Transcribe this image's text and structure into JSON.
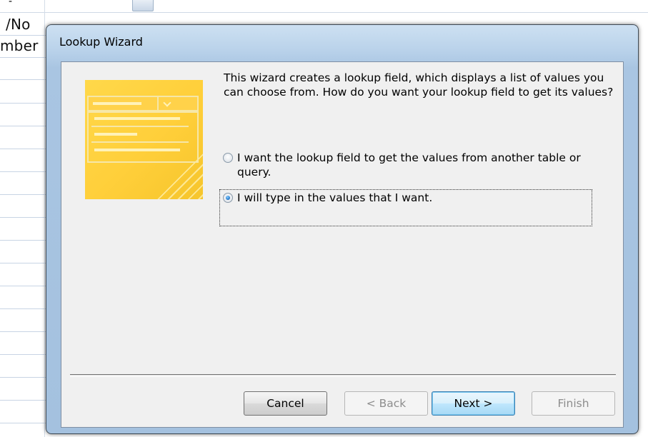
{
  "background": {
    "partial_top_text": "-",
    "visible_cells": [
      "/No",
      "mber"
    ]
  },
  "dialog": {
    "title": "Lookup Wizard",
    "description": "This wizard creates a lookup field, which displays a list of values you can choose from.  How do you want your lookup field to get its values?",
    "options": [
      {
        "label": "I want the lookup field to get the values from another table or query.",
        "selected": false
      },
      {
        "label": "I will type in the values that I want.",
        "selected": true
      }
    ],
    "buttons": {
      "cancel": "Cancel",
      "back": "< Back",
      "next": "Next >",
      "finish": "Finish"
    },
    "button_states": {
      "back_enabled": false,
      "finish_enabled": false,
      "default": "next"
    }
  },
  "colors": {
    "title_bar": "#b9d2ea",
    "client": "#f0f0f0",
    "illustration": "#ffd24a",
    "radio_selected": "#2a7fd0"
  }
}
